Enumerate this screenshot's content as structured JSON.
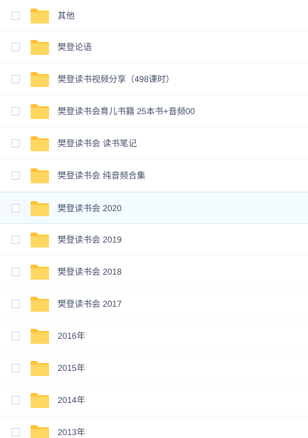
{
  "colors": {
    "folder_back": "#ffc234",
    "folder_front": "#ffd760",
    "text": "#424e67",
    "row_divider": "#f2f6fd",
    "highlight_bg": "#f4fbff",
    "checkbox_border": "#cfd6e0"
  },
  "folder_icon": "folder-icon",
  "rows": [
    {
      "name": "其他"
    },
    {
      "name": "樊登论语"
    },
    {
      "name": "樊登读书视频分享（498课时）"
    },
    {
      "name": "樊登读书会育儿书籍 25本书+音频00"
    },
    {
      "name": "樊登读书会 读书笔记"
    },
    {
      "name": "樊登读书会 纯音频合集"
    },
    {
      "name": "樊登读书会 2020"
    },
    {
      "name": "樊登读书会 2019"
    },
    {
      "name": "樊登读书会 2018"
    },
    {
      "name": "樊登读书会 2017"
    },
    {
      "name": "2016年"
    },
    {
      "name": "2015年"
    },
    {
      "name": "2014年"
    },
    {
      "name": "2013年"
    }
  ]
}
